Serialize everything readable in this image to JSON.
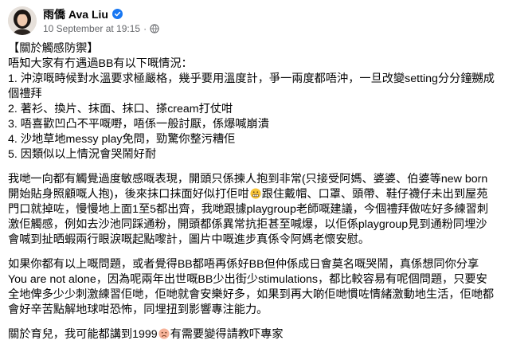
{
  "post": {
    "author": "雨僑 Ava Liu",
    "timestamp": "10 September at 19:15",
    "separator": "·",
    "verified_icon": "verified-badge-icon",
    "privacy_icon": "globe-icon",
    "colors": {
      "verified": "#1877f2",
      "meta_text": "#65676b",
      "body_text": "#050505"
    }
  },
  "content": {
    "p1": [
      "【關於觸感防禦】",
      "唔知大家有冇遇過BB有以下嘅情況：",
      "1. 沖涼嘅時候對水溫要求極嚴格，幾乎要用溫度計，爭一兩度都唔沖，一旦改變setting分分鐘嬲成",
      "個禮拜",
      "2. 著衫、換片、抹面、抹口、搽cream打仗咁",
      "3. 唔喜歡凹凸不平嘅嘢，唔係一般討厭，係爆喊崩潰",
      "4. 沙地草地messy play免問，勁驚你整污糟佢",
      "5. 因類似以上情況會哭鬧好耐"
    ],
    "p2": {
      "l1": "我哋一向都有觸覺過度敏感嘅表現，開頭只係揀人抱到非常(只接受阿媽、婆婆、伯婆等new born",
      "l2": "開始貼身照顧嘅人抱)，後來抹口抹面好似打佢咁",
      "l2b": "跟住戴帽、口罩、頭帶、鞋仔襪仔未出到屋苑",
      "l3": "門口就掉咗，慢慢地上面1至5都出齊，我哋跟據playgroup老師嘅建議，今個禮拜做咗好多練習刺",
      "l4": "激佢觸感，例如去沙池同踩通粉，開頭都係異常抗拒甚至喊爆，以佢係playgroup見到通粉同埋沙",
      "l5": "會喊到扯晒蝦兩行眼淚嘅起點嚟計，圖片中嘅進步真係令阿媽老懷安慰。"
    },
    "p3": [
      "如果你都有以上嘅問題，或者覺得BB都唔再係好BB但仲係成日會莫名嘅哭鬧，真係想同你分享",
      "You are not alone，因為呢兩年出世嘅BB少出街少stimulations，都比較容易有呢個問題，只要安",
      "全地俾多少少刺激練習佢哋，佢哋就會安樂好多，如果到再大啲佢哋慣咗情緒激動地生活，佢哋都",
      "會好辛苦點解地球咁恐怖，同埋扭到影響專注能力。"
    ],
    "p4": {
      "before": "關於育兒，我可能都講到1999",
      "after": "有需要變得請教吓專家"
    }
  }
}
